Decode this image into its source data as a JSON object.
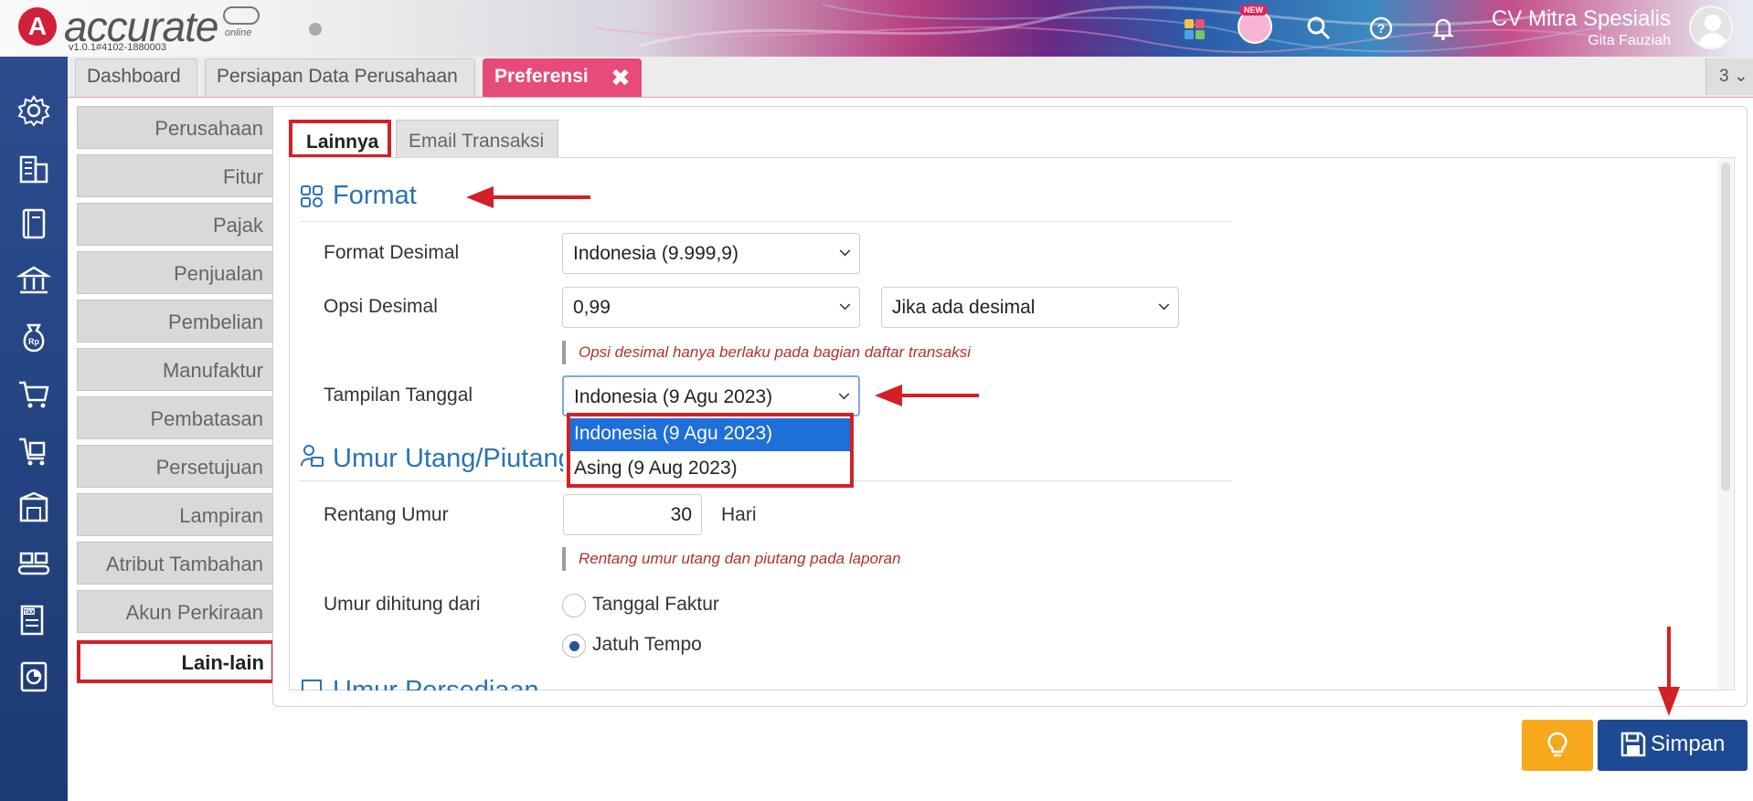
{
  "header": {
    "logo_text": "accurate",
    "logo_sub": "online",
    "version": "v1.0.1#4102-1880003",
    "new_badge": "NEW",
    "company_name": "CV Mitra Spesialis",
    "user_name": "Gita Fauziah"
  },
  "tabs": {
    "dashboard": "Dashboard",
    "persiapan": "Persiapan Data Perusahaan",
    "preferensi": "Preferensi",
    "close": "✖",
    "count": "3 ⌄"
  },
  "categories": [
    "Perusahaan",
    "Fitur",
    "Pajak",
    "Penjualan",
    "Pembelian",
    "Manufaktur",
    "Pembatasan",
    "Persetujuan",
    "Lampiran",
    "Atribut Tambahan",
    "Akun Perkiraan",
    "Lain-lain"
  ],
  "active_category": "Lain-lain",
  "subtabs": {
    "lainnya": "Lainnya",
    "email": "Email Transaksi"
  },
  "format": {
    "title": "Format",
    "format_desimal_label": "Format Desimal",
    "format_desimal_value": "Indonesia (9.999,9)",
    "opsi_desimal_label": "Opsi Desimal",
    "opsi_desimal_value": "0,99",
    "opsi_desimal_mode": "Jika ada desimal",
    "opsi_desimal_hint": "Opsi desimal hanya berlaku pada bagian daftar transaksi",
    "tampilan_tanggal_label": "Tampilan Tanggal",
    "tampilan_tanggal_value": "Indonesia (9 Agu 2023)",
    "tampilan_tanggal_options": [
      "Indonesia (9 Agu 2023)",
      "Asing (9 Aug 2023)"
    ]
  },
  "umur": {
    "title": "Umur Utang/Piutang",
    "rentang_label": "Rentang Umur",
    "rentang_value": "30",
    "rentang_unit": "Hari",
    "rentang_hint": "Rentang umur utang dan piutang pada laporan",
    "dihitung_label": "Umur dihitung dari",
    "radio_faktur": "Tanggal Faktur",
    "radio_jatuh_tempo": "Jatuh Tempo",
    "selected": "Jatuh Tempo"
  },
  "persediaan": {
    "title": "Umur Persediaan"
  },
  "buttons": {
    "save": "Simpan"
  },
  "colors": {
    "accent_red": "#d32026",
    "tab_pink": "#e74b7b",
    "link_blue": "#2a72b5",
    "save_blue": "#1e4a93",
    "tip_orange": "#f7a81c",
    "sidebar_blue": "#1d3b74"
  }
}
